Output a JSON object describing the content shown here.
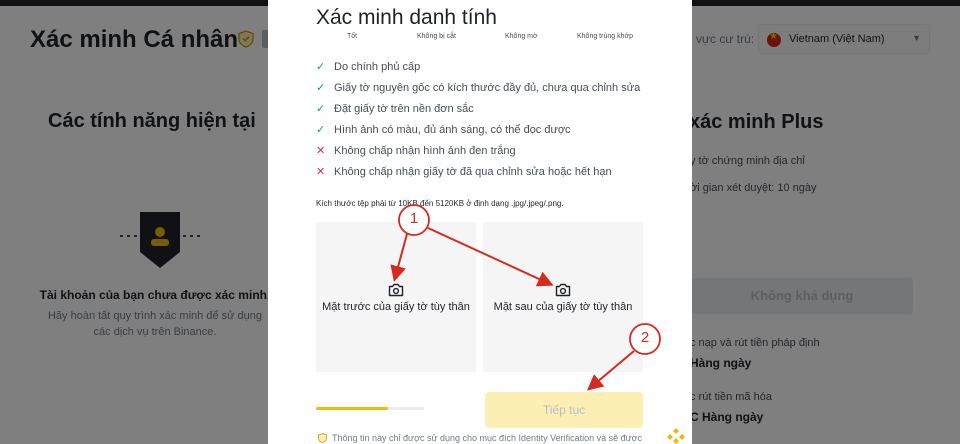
{
  "background": {
    "page_title": "Xác minh Cá nhân",
    "region_label": "u vực cư trú:",
    "region_value": "Vietnam (Việt Nam)",
    "features_title": "Các tính năng hiện tại",
    "unverified_title": "Tài khoản của bạn chưa được xác minh.",
    "unverified_desc": "Hãy hoàn tất quy trình xác minh để sử dụng các dịch vụ trên Binance.",
    "plus_title": "xác minh Plus",
    "plus_items": [
      "y tờ chứng minh địa chỉ",
      "ời gian xét duyệt: 10 ngày"
    ],
    "unavailable_label": "Không khả dụng",
    "limit_rows": [
      {
        "label": "c nạp và rút tiền pháp định",
        "value": "Hàng ngày"
      },
      {
        "label": "c rút tiền mã hóa",
        "value": "C Hàng ngày"
      }
    ]
  },
  "modal": {
    "title": "Xác minh danh tính",
    "examples": [
      "Tốt",
      "Không bị cắt",
      "Không mờ",
      "Không trùng khớp"
    ],
    "requirements": [
      {
        "ok": true,
        "text": "Do chính phủ cấp"
      },
      {
        "ok": true,
        "text": "Giấy tờ nguyên gốc có kích thước đầy đủ, chưa qua chỉnh sửa"
      },
      {
        "ok": true,
        "text": "Đặt giấy tờ trên nền đơn sắc"
      },
      {
        "ok": true,
        "text": "Hình ảnh có màu, đủ ánh sáng, có thể đọc được"
      },
      {
        "ok": false,
        "text": "Không chấp nhận hình ảnh đen trắng"
      },
      {
        "ok": false,
        "text": "Không chấp nhận giấy tờ đã qua chỉnh sửa hoặc hết hạn"
      }
    ],
    "size_note": "Kích thước tệp phải từ 10KB đến 5120KB ở định dạng .jpg/.jpeg/.png.",
    "front_label": "Mặt trước của giấy tờ tùy thân",
    "back_label": "Mặt sau của giấy tờ tùy thân",
    "progress_fraction": 0.67,
    "continue_label": "Tiếp tục",
    "footer_note": "Thông tin này chỉ được sử dụng cho mục đích Identity Verification và sẽ được"
  },
  "annotations": [
    "1",
    "2"
  ],
  "colors": {
    "accent": "#f0b90b",
    "annotation_red": "#d42b1e",
    "ok_green": "#03a66d",
    "error_red": "#cf304a"
  }
}
